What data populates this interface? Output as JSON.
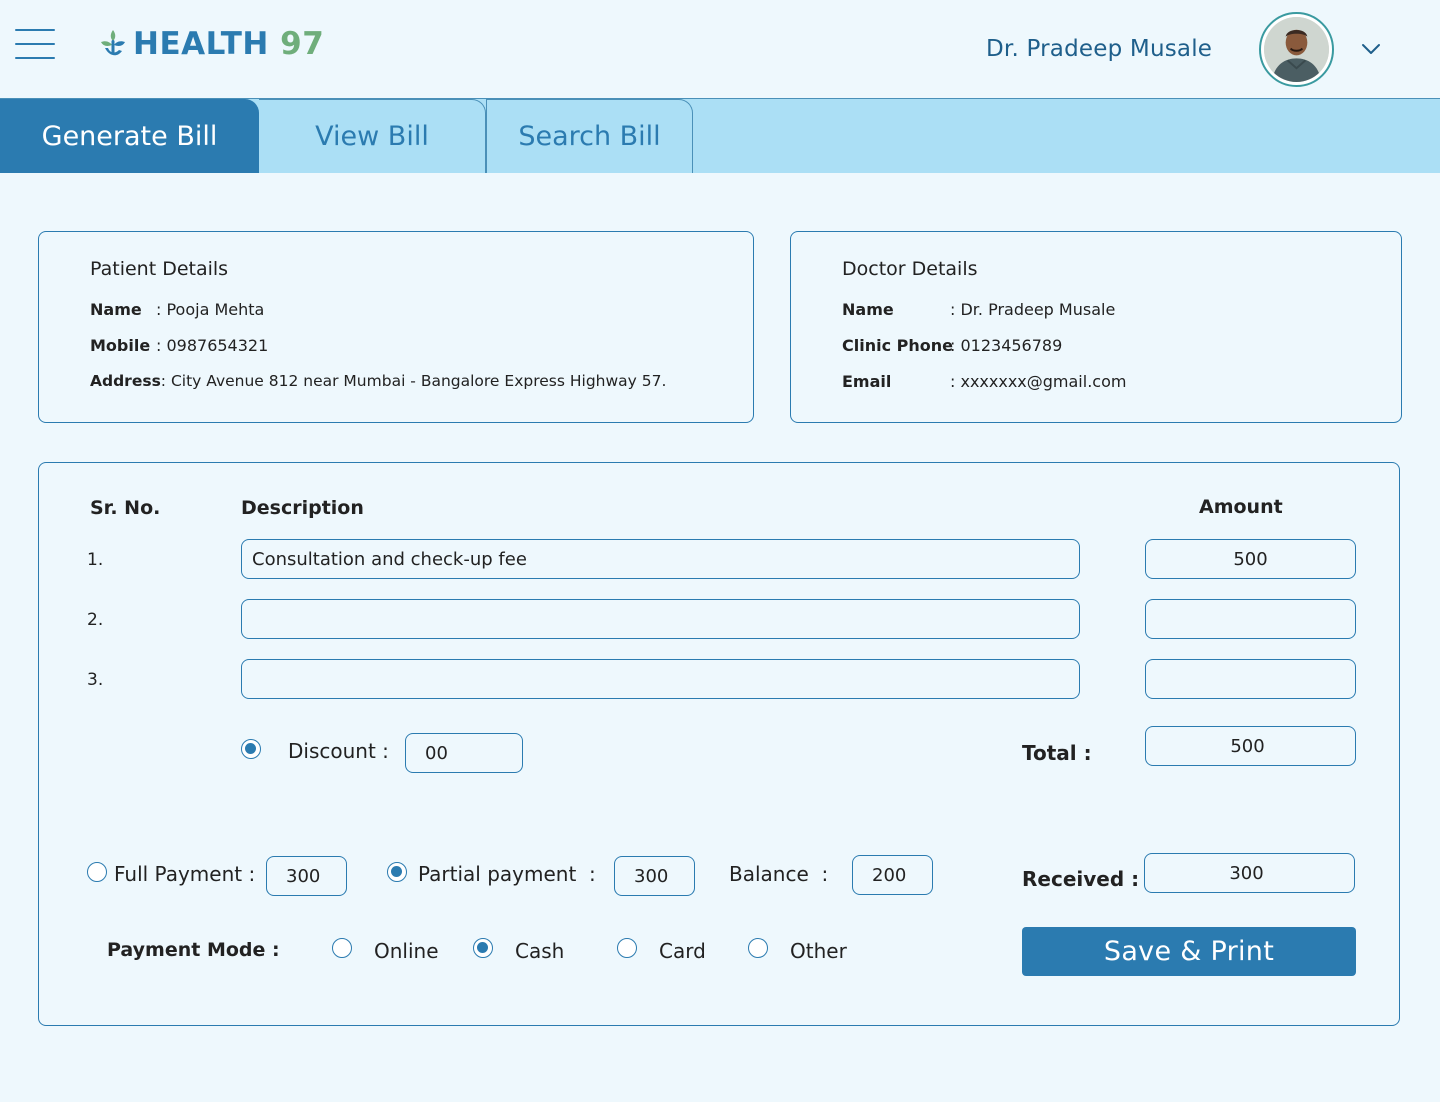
{
  "header": {
    "logo_word1": "HEALTH",
    "logo_word2": "97",
    "doctor_name": "Dr. Pradeep Musale"
  },
  "tabs": [
    {
      "label": "Generate Bill",
      "active": true
    },
    {
      "label": "View Bill",
      "active": false
    },
    {
      "label": "Search Bill",
      "active": false
    }
  ],
  "patient": {
    "title": "Patient Details",
    "name_label": "Name",
    "name_value": ": Pooja Mehta",
    "mobile_label": "Mobile",
    "mobile_value": ": 0987654321",
    "address_label": "Address",
    "address_value": ": City Avenue 812 near Mumbai - Bangalore Express Highway 57."
  },
  "doctor": {
    "title": "Doctor Details",
    "name_label": "Name",
    "name_value": ": Dr. Pradeep Musale",
    "phone_label": "Clinic Phone",
    "phone_value": ": 0123456789",
    "email_label": "Email",
    "email_value": ": xxxxxxx@gmail.com"
  },
  "bill": {
    "col_srno": "Sr. No.",
    "col_desc": "Description",
    "col_amount": "Amount",
    "rows": [
      {
        "sr": "1.",
        "description": "Consultation and check-up fee",
        "amount": "500"
      },
      {
        "sr": "2.",
        "description": "",
        "amount": ""
      },
      {
        "sr": "3.",
        "description": "",
        "amount": ""
      }
    ],
    "discount_label": "Discount :",
    "discount_value": "00",
    "total_label": "Total :",
    "total_value": "500",
    "full_payment_label": "Full Payment :",
    "full_payment_value": "300",
    "partial_payment_label": "Partial payment  :",
    "partial_payment_value": "300",
    "balance_label": "Balance  :",
    "balance_value": "200",
    "received_label": "Received :",
    "received_value": "300",
    "payment_mode_label": "Payment Mode :",
    "modes": [
      {
        "label": "Online",
        "selected": false
      },
      {
        "label": "Cash",
        "selected": true
      },
      {
        "label": "Card",
        "selected": false
      },
      {
        "label": "Other",
        "selected": false
      }
    ],
    "save_label": "Save & Print"
  },
  "colors": {
    "primary": "#2b7bb0",
    "tabbar": "#abdff5",
    "background": "#eef8fd",
    "logo_green": "#6fae7b"
  }
}
